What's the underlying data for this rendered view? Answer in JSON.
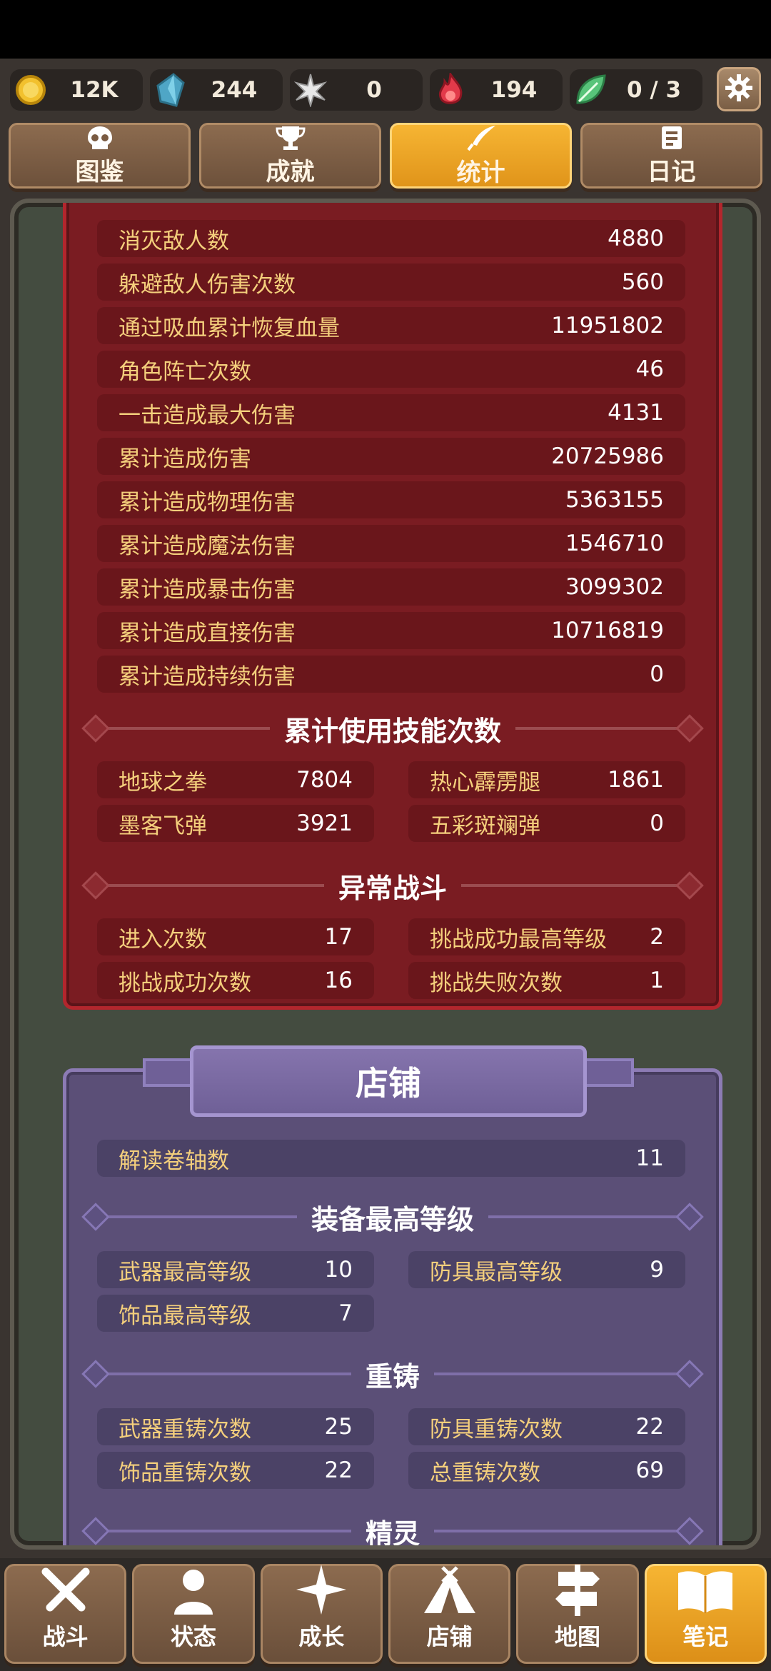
{
  "resources": {
    "gold": "12K",
    "crystal": "244",
    "star": "0",
    "flame": "194",
    "leaf": "0 / 3"
  },
  "tabs": [
    {
      "label": "图鉴",
      "icon": "skull-icon"
    },
    {
      "label": "成就",
      "icon": "trophy-icon"
    },
    {
      "label": "统计",
      "icon": "quill-icon"
    },
    {
      "label": "日记",
      "icon": "notes-icon"
    }
  ],
  "combat_stats": [
    {
      "label": "消灭敌人数",
      "value": "4880"
    },
    {
      "label": "躲避敌人伤害次数",
      "value": "560"
    },
    {
      "label": "通过吸血累计恢复血量",
      "value": "11951802"
    },
    {
      "label": "角色阵亡次数",
      "value": "46"
    },
    {
      "label": "一击造成最大伤害",
      "value": "4131"
    },
    {
      "label": "累计造成伤害",
      "value": "20725986"
    },
    {
      "label": "累计造成物理伤害",
      "value": "5363155"
    },
    {
      "label": "累计造成魔法伤害",
      "value": "1546710"
    },
    {
      "label": "累计造成暴击伤害",
      "value": "3099302"
    },
    {
      "label": "累计造成直接伤害",
      "value": "10716819"
    },
    {
      "label": "累计造成持续伤害",
      "value": "0"
    }
  ],
  "skills": {
    "title": "累计使用技能次数",
    "items": [
      {
        "label": "地球之拳",
        "value": "7804"
      },
      {
        "label": "热心霹雳腿",
        "value": "1861"
      },
      {
        "label": "墨客飞弹",
        "value": "3921"
      },
      {
        "label": "五彩斑斓弹",
        "value": "0"
      }
    ]
  },
  "abnormal": {
    "title": "异常战斗",
    "items": [
      {
        "label": "进入次数",
        "value": "17"
      },
      {
        "label": "挑战成功最高等级",
        "value": "2"
      },
      {
        "label": "挑战成功次数",
        "value": "16"
      },
      {
        "label": "挑战失败次数",
        "value": "1"
      }
    ]
  },
  "shop": {
    "title": "店铺",
    "scroll": {
      "label": "解读卷轴数",
      "value": "11"
    },
    "equip_title": "装备最高等级",
    "equip": [
      {
        "label": "武器最高等级",
        "value": "10"
      },
      {
        "label": "防具最高等级",
        "value": "9"
      },
      {
        "label": "饰品最高等级",
        "value": "7"
      }
    ],
    "reforge_title": "重铸",
    "reforge": [
      {
        "label": "武器重铸次数",
        "value": "25"
      },
      {
        "label": "防具重铸次数",
        "value": "22"
      },
      {
        "label": "饰品重铸次数",
        "value": "22"
      },
      {
        "label": "总重铸次数",
        "value": "69"
      }
    ],
    "spirit_title": "精灵"
  },
  "nav": [
    {
      "label": "战斗",
      "icon": "crossed-swords-icon"
    },
    {
      "label": "状态",
      "icon": "person-icon"
    },
    {
      "label": "成长",
      "icon": "sparkle-icon"
    },
    {
      "label": "店铺",
      "icon": "tent-icon"
    },
    {
      "label": "地图",
      "icon": "signpost-icon"
    },
    {
      "label": "笔记",
      "icon": "book-icon"
    }
  ]
}
